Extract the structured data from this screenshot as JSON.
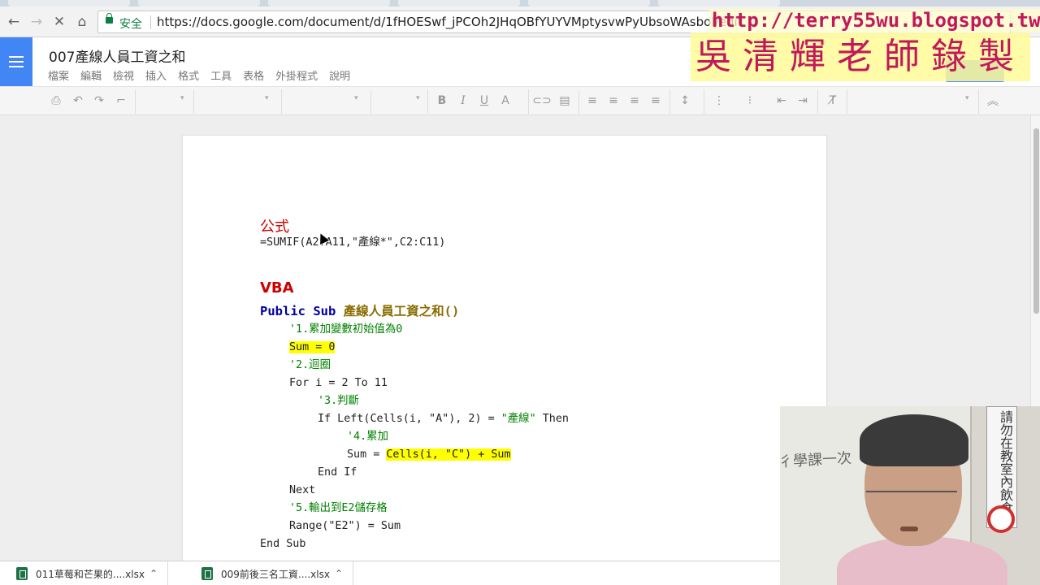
{
  "browser": {
    "secure_label": "安全",
    "url": "https://docs.google.com/document/d/1fHOESwf_jPCOh2JHqOBfYUYVMptysvwPyUbsoWAsboI/edit",
    "back_icon": "arrow-left-icon",
    "forward_icon": "arrow-right-icon",
    "reload_icon": "close-x-icon",
    "home_icon": "home-icon",
    "lock_icon": "lock-icon",
    "bookmark_icon": "star-icon"
  },
  "watermark": {
    "url": "http://terry55wu.blogspot.tw",
    "name": "吳清輝老師錄製"
  },
  "docs": {
    "title": "007產線人員工資之和",
    "menu": [
      "檔案",
      "編輯",
      "檢視",
      "插入",
      "格式",
      "工具",
      "表格",
      "外掛程式",
      "說明"
    ],
    "accent_color": "#4285f4"
  },
  "document": {
    "formula_heading": "公式",
    "formula": "=SUMIF(A2:A11,\"產線*\",C2:C11)",
    "vba_heading": "VBA",
    "sub_keyword": "Public Sub",
    "sub_name": "產線人員工資之和()",
    "code": {
      "c1": "'1.累加變數初始值為0",
      "l1": "Sum = 0",
      "c2": "'2.迴圈",
      "l2": "For i = 2 To 11",
      "c3": "'3.判斷",
      "l3a": "If Left(Cells(i, \"A\"), 2) = ",
      "l3b": "\"產線\"",
      "l3c": " Then",
      "c4": "'4.累加",
      "l4a": "Sum = ",
      "l4b": "Cells(i, \"C\") + Sum",
      "l5": "End If",
      "l6": "Next",
      "c5": "'5.輸出到E2儲存格",
      "l7": "Range(\"E2\") = Sum",
      "l8": "End Sub"
    },
    "highlight_color": "#ffff00",
    "heading_color": "#cc0000"
  },
  "webcam": {
    "board_text": "彳學課一次",
    "sign_text": "請勿在教室內飲食"
  },
  "downloads": [
    {
      "name": "011草莓和芒果的....xlsx"
    },
    {
      "name": "009前後三名工資....xlsx"
    }
  ]
}
